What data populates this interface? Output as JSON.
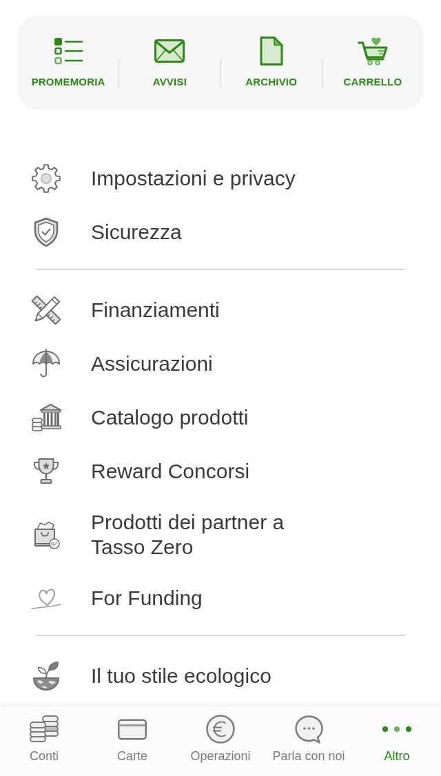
{
  "shortcuts": [
    {
      "label": "PROMEMORIA"
    },
    {
      "label": "AVVISI"
    },
    {
      "label": "ARCHIVIO"
    },
    {
      "label": "CARRELLO"
    }
  ],
  "menu_sections": [
    {
      "items": [
        {
          "label": "Impostazioni e privacy"
        },
        {
          "label": "Sicurezza"
        }
      ]
    },
    {
      "items": [
        {
          "label": "Finanziamenti"
        },
        {
          "label": "Assicurazioni"
        },
        {
          "label": "Catalogo prodotti"
        },
        {
          "label": "Reward Concorsi"
        },
        {
          "label": "Prodotti dei partner a Tasso Zero"
        },
        {
          "label": "For Funding"
        }
      ]
    },
    {
      "items": [
        {
          "label": "Il tuo stile ecologico"
        }
      ]
    }
  ],
  "tab_bar": [
    {
      "label": "Conti",
      "selected": false
    },
    {
      "label": "Carte",
      "selected": false
    },
    {
      "label": "Operazioni",
      "selected": false
    },
    {
      "label": "Parla con noi",
      "selected": false
    },
    {
      "label": "Altro",
      "selected": true
    }
  ]
}
